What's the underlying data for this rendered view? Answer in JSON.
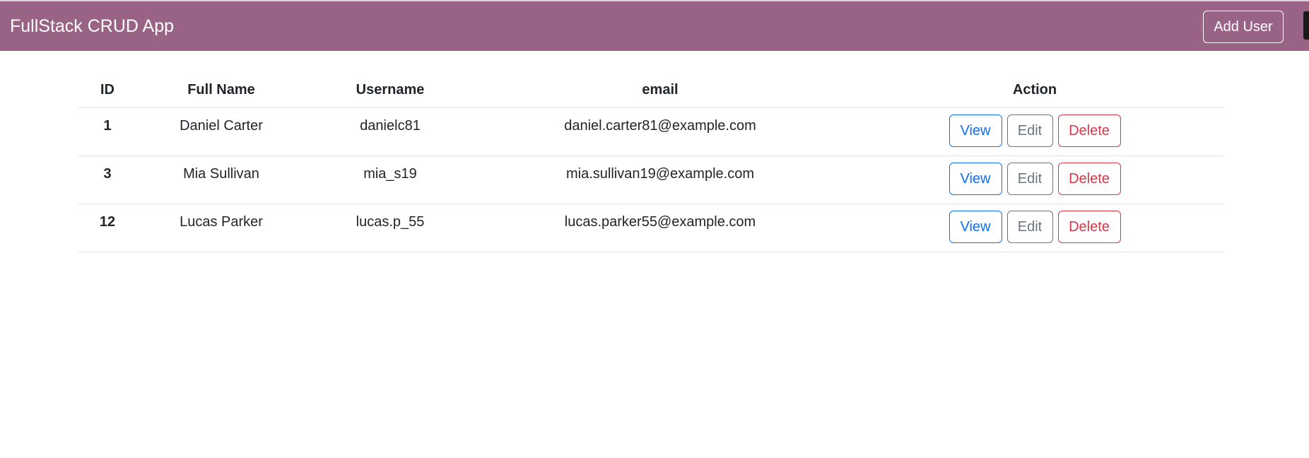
{
  "navbar": {
    "brand": "FullStack CRUD App",
    "add_user_label": "Add User",
    "background": "#996386"
  },
  "table": {
    "headers": [
      "ID",
      "Full Name",
      "Username",
      "email",
      "Action"
    ],
    "rows": [
      {
        "id": "1",
        "full_name": "Daniel Carter",
        "username": "danielc81",
        "email": "daniel.carter81@example.com"
      },
      {
        "id": "3",
        "full_name": "Mia Sullivan",
        "username": "mia_s19",
        "email": "mia.sullivan19@example.com"
      },
      {
        "id": "12",
        "full_name": "Lucas Parker",
        "username": "lucas.p_55",
        "email": "lucas.parker55@example.com"
      }
    ],
    "actions": {
      "view_label": "View",
      "edit_label": "Edit",
      "delete_label": "Delete"
    }
  },
  "colors": {
    "view": "#0d6efd",
    "edit": "#6c757d",
    "delete": "#dc3545"
  }
}
